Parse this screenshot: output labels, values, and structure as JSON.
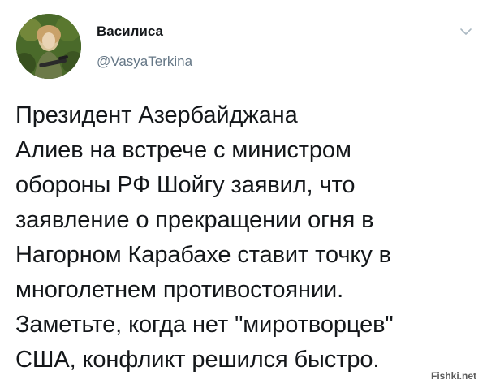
{
  "tweet": {
    "author": {
      "display_name": "Василиса",
      "handle": "@VasyaTerkina",
      "avatar_icon": "profile-photo"
    },
    "menu_icon": "chevron-down-icon",
    "text": "Президент Азербайджана\nАлиев на встрече с министром\nобороны РФ Шойгу заявил, что\nзаявление о прекращении огня в\nНагорном Карабахе ставит точку в\nмноголетнем противостоянии.\nЗаметьте, когда нет \"миротворцев\"\nСША, конфликт решился быстро."
  },
  "watermark": {
    "text": "Fishki.net"
  },
  "colors": {
    "text": "#14171a",
    "secondary": "#657786",
    "chevron": "#aab8c2"
  }
}
